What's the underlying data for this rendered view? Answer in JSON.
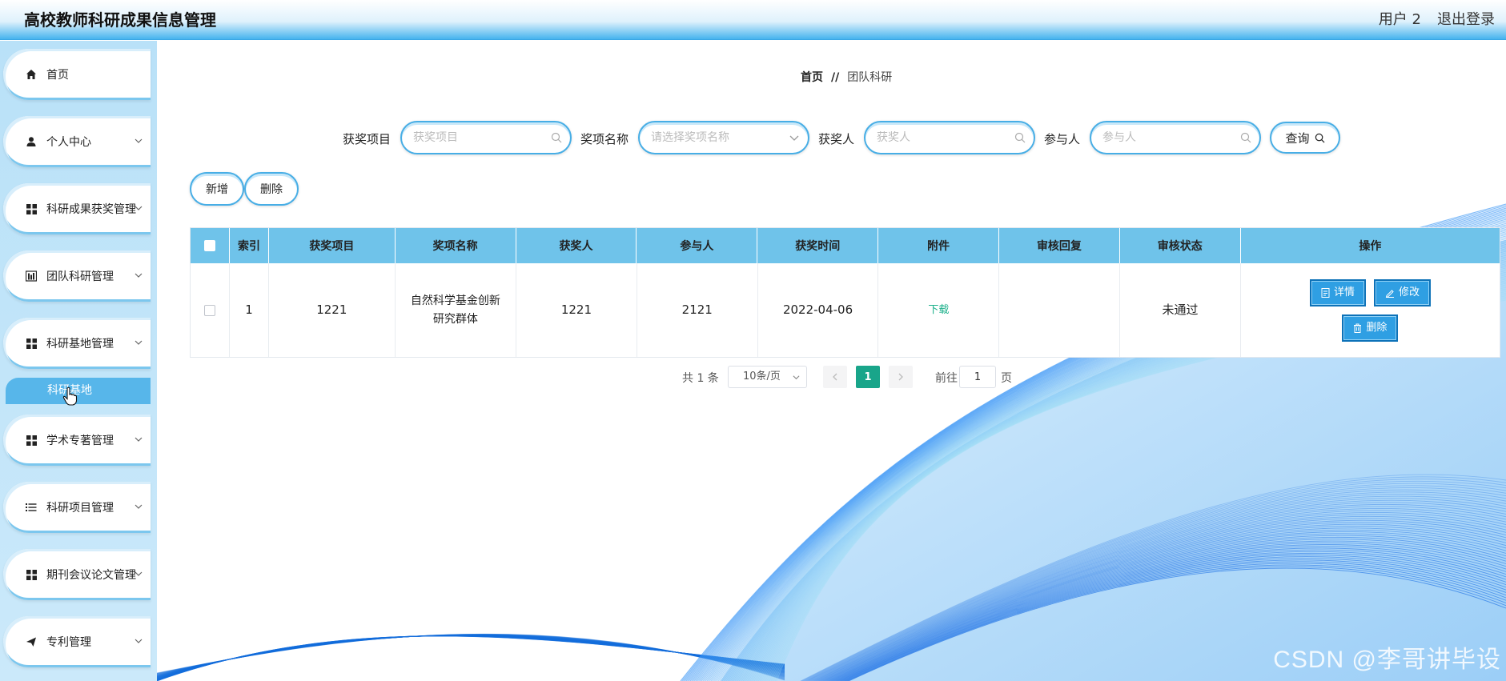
{
  "header": {
    "title": "高校教师科研成果信息管理",
    "user": "用户 2",
    "logout": "退出登录"
  },
  "sidebar": {
    "items": [
      {
        "label": "首页",
        "icon": "home-icon",
        "has_arrow": false
      },
      {
        "label": "个人中心",
        "icon": "user-icon",
        "has_arrow": true
      },
      {
        "label": "科研成果获奖管理",
        "icon": "grid-icon",
        "has_arrow": true
      },
      {
        "label": "团队科研管理",
        "icon": "chart-icon",
        "has_arrow": true
      },
      {
        "label": "科研基地管理",
        "icon": "grid-icon",
        "has_arrow": true
      },
      {
        "label": "学术专著管理",
        "icon": "grid-icon",
        "has_arrow": true
      },
      {
        "label": "科研项目管理",
        "icon": "list-icon",
        "has_arrow": true
      },
      {
        "label": "期刊会议论文管理",
        "icon": "grid-icon",
        "has_arrow": true
      },
      {
        "label": "专利管理",
        "icon": "send-icon",
        "has_arrow": true
      }
    ],
    "submenu": {
      "label": "科研基地"
    }
  },
  "breadcrumb": {
    "home": "首页",
    "separator": "//",
    "current": "团队科研"
  },
  "search": {
    "award_project": {
      "label": "获奖项目",
      "placeholder": "获奖项目"
    },
    "award_name": {
      "label": "奖项名称",
      "placeholder": "请选择奖项名称"
    },
    "winner": {
      "label": "获奖人",
      "placeholder": "获奖人"
    },
    "participant": {
      "label": "参与人",
      "placeholder": "参与人"
    },
    "query_button": "查询"
  },
  "actions": {
    "add": "新增",
    "delete": "删除"
  },
  "table": {
    "columns": [
      "索引",
      "获奖项目",
      "奖项名称",
      "获奖人",
      "参与人",
      "获奖时间",
      "附件",
      "审核回复",
      "审核状态",
      "操作"
    ],
    "rows": [
      {
        "index": "1",
        "award_project": "1221",
        "award_name": "自然科学基金创新研究群体",
        "winner": "1221",
        "participant": "2121",
        "award_time": "2022-04-06",
        "attachment": "下载",
        "review_reply": "",
        "review_status": "未通过",
        "ops": {
          "detail": "详情",
          "edit": "修改",
          "delete": "删除"
        }
      }
    ]
  },
  "pagination": {
    "total": "共 1 条",
    "page_size": "10条/页",
    "current_page": "1",
    "goto_label": "前往",
    "goto_value": "1",
    "page_label": "页"
  },
  "watermark": "CSDN @李哥讲毕设",
  "colors": {
    "accent": "#47aee6",
    "table_header": "#6fc3ea",
    "op_button": "#2f9fe3",
    "page_active": "#19a58a"
  }
}
